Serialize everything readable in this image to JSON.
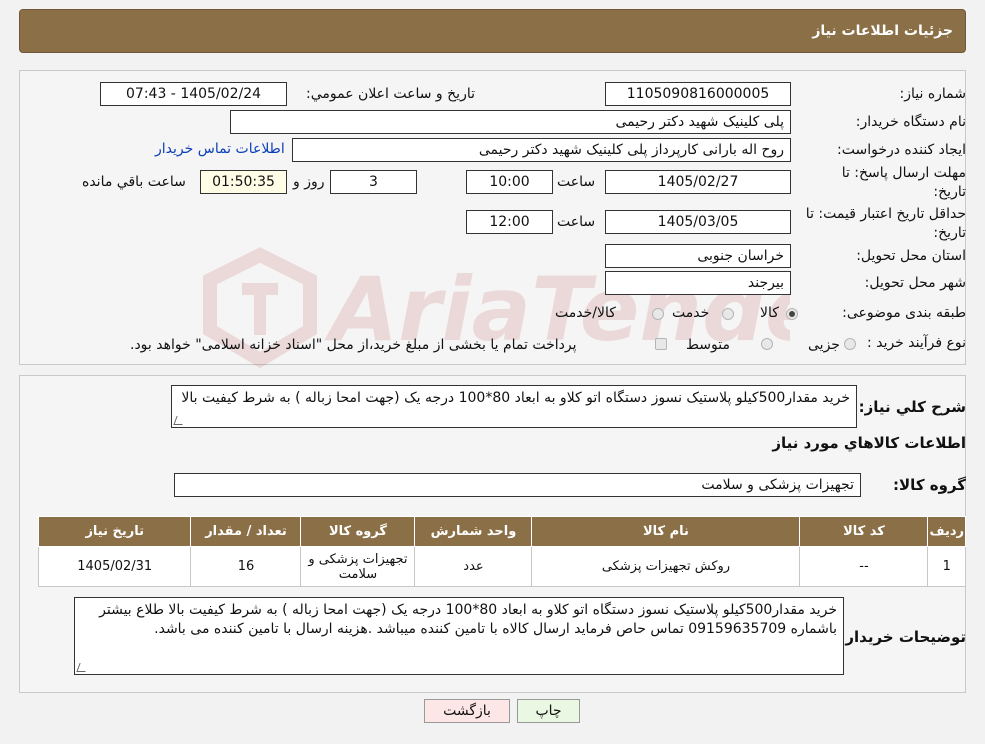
{
  "header": {
    "title": "جزئیات اطلاعات نیاز"
  },
  "form": {
    "need_number": {
      "label": "شماره نیاز:",
      "value": "1105090816000005"
    },
    "announce_datetime": {
      "label": "تاریخ و ساعت اعلان عمومي:",
      "value": "1405/02/24 - 07:43"
    },
    "buyer_org": {
      "label": "نام دستگاه خریدار:",
      "value": "پلی کلینیک شهید دکتر رحیمی"
    },
    "requester": {
      "label": "ایجاد کننده درخواست:",
      "value": "روح اله بارانی کارپرداز پلی کلینیک شهید دکتر رحیمی",
      "contact_link": "اطلاعات تماس خریدار"
    },
    "reply_deadline": {
      "label_line1": "مهلت ارسال پاسخ: تا",
      "label_line2": "تاریخ:",
      "date": "1405/02/27",
      "time_label": "ساعت",
      "time": "10:00",
      "days": "3",
      "days_label": "روز و",
      "remaining": "01:50:35",
      "remaining_label": "ساعت باقي مانده"
    },
    "price_validity": {
      "label_line1": "حداقل تاریخ اعتبار قیمت: تا",
      "label_line2": "تاریخ:",
      "date": "1405/03/05",
      "time_label": "ساعت",
      "time": "12:00"
    },
    "province": {
      "label": "استان محل تحویل:",
      "value": "خراسان جنوبی"
    },
    "city": {
      "label": "شهر محل تحویل:",
      "value": "بیرجند"
    },
    "category": {
      "label": "طبقه بندی موضوعی:",
      "options": [
        "کالا",
        "خدمت",
        "کالا/خدمت"
      ],
      "selected": "کالا"
    },
    "purchase_type": {
      "label": "نوع فرآیند خرید :",
      "options": [
        "جزیی",
        "متوسط"
      ],
      "note": "پرداخت تمام یا بخشی از مبلغ خرید،از محل \"اسناد خزانه اسلامی\" خواهد بود."
    }
  },
  "summary": {
    "label": "شرح کلي نياز:",
    "value": "خرید مقدار500کیلو پلاستیک نسوز  دستگاه اتو کلاو به ابعاد 80*100 درجه یک (جهت امحا زباله ) به شرط کیفیت بالا"
  },
  "goods_section": {
    "title": "اطلاعات کالاهاي مورد نياز",
    "group_label": "گروه کالا:",
    "group_value": "تجهیزات پزشکی و سلامت"
  },
  "table": {
    "headers": [
      "رديف",
      "کد کالا",
      "نام کالا",
      "واحد شمارش",
      "گروه کالا",
      "تعداد / مقدار",
      "تاريخ نياز"
    ],
    "rows": [
      [
        "1",
        "--",
        "روکش تجهیزات پزشکی",
        "عدد",
        "تجهیزات پزشکی و سلامت",
        "16",
        "1405/02/31"
      ]
    ]
  },
  "buyer_notes": {
    "label": "توضیحات خریدار:",
    "value": "خرید مقدار500کیلو پلاستیک نسوز  دستگاه اتو کلاو به ابعاد 80*100 درجه یک (جهت امحا زباله ) به شرط کیفیت بالا طلاع بیشتر باشماره 09159635709 تماس حاص فرماید ارسال کالاه با تامین کننده میباشد .هزینه ارسال با تامین کننده می باشد."
  },
  "buttons": {
    "print": "چاپ",
    "back": "بازگشت"
  },
  "colors": {
    "header_bg": "#8b6f47",
    "back_button_bg": "#fde6e6",
    "print_button_bg": "#eaf7e3",
    "link": "#0a3fb8"
  }
}
